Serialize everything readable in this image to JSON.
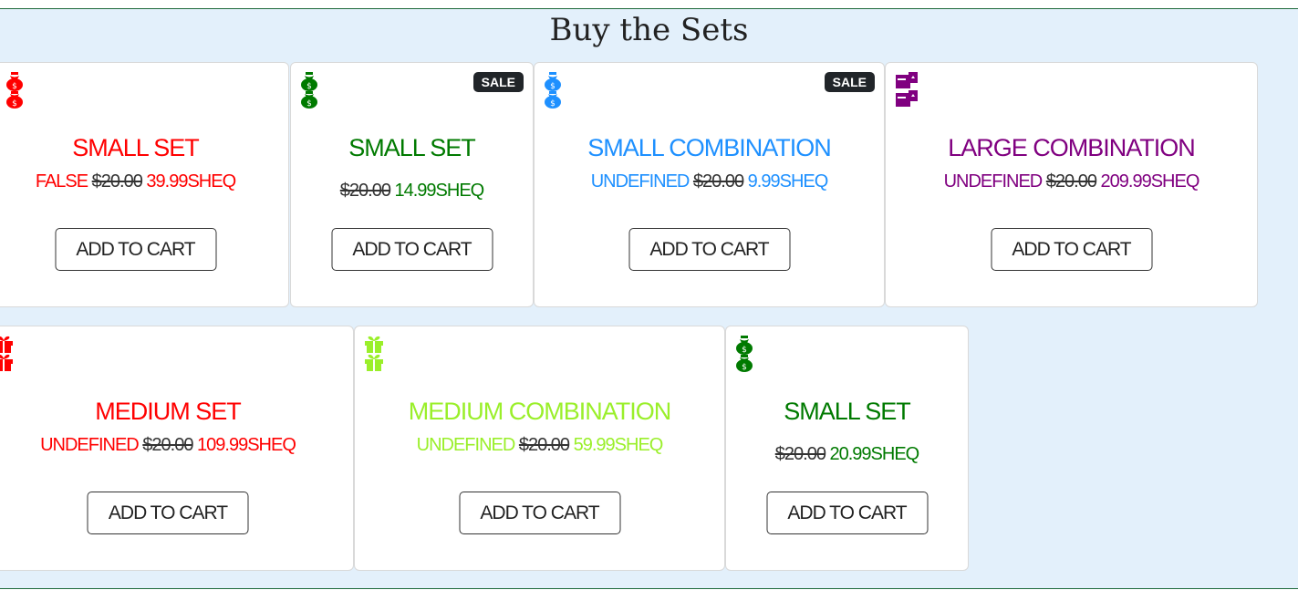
{
  "section": {
    "title": "Buy the Sets"
  },
  "cards": [
    {
      "name": "SMALL SET",
      "prefix": "FALSE",
      "old_price": "$20.00",
      "new_price": "39.99SHEQ",
      "color": "#ff0000",
      "icon": "money-bag-icon",
      "sale": "",
      "button": "ADD TO CART"
    },
    {
      "name": "SMALL SET",
      "prefix": "",
      "old_price": "$20.00",
      "new_price": "14.99SHEQ",
      "color": "#007a00",
      "icon": "money-bag-icon",
      "sale": "SALE",
      "button": "ADD TO CART"
    },
    {
      "name": "SMALL COMBINATION",
      "prefix": "UNDEFINED",
      "old_price": "$20.00",
      "new_price": "9.99SHEQ",
      "color": "#1e90ff",
      "icon": "money-bag-icon",
      "sale": "SALE",
      "button": "ADD TO CART"
    },
    {
      "name": "LARGE COMBINATION",
      "prefix": "UNDEFINED",
      "old_price": "$20.00",
      "new_price": "209.99SHEQ",
      "color": "#800080",
      "icon": "boxes-icon",
      "sale": "",
      "button": "ADD TO CART"
    },
    {
      "name": "MEDIUM SET",
      "prefix": "UNDEFINED",
      "old_price": "$20.00",
      "new_price": "109.99SHEQ",
      "color": "#ff0000",
      "icon": "gift-icon",
      "sale": "",
      "button": "ADD TO CART"
    },
    {
      "name": "MEDIUM COMBINATION",
      "prefix": "UNDEFINED",
      "old_price": "$20.00",
      "new_price": "59.99SHEQ",
      "color": "#9aef2a",
      "icon": "gift-icon",
      "sale": "",
      "button": "ADD TO CART"
    },
    {
      "name": "SMALL SET",
      "prefix": "",
      "old_price": "$20.00",
      "new_price": "20.99SHEQ",
      "color": "#007a00",
      "icon": "money-bag-icon",
      "sale": "",
      "button": "ADD TO CART"
    }
  ]
}
